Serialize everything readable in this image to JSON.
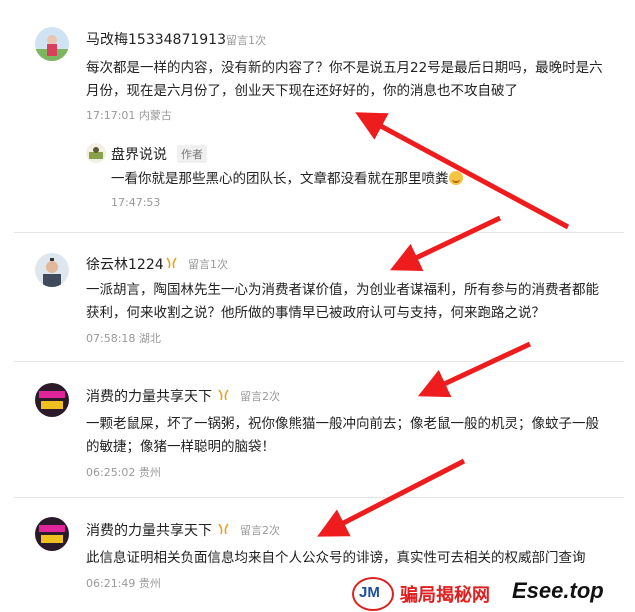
{
  "comments": [
    {
      "name": "马改梅15334871913",
      "count": "留言1次",
      "text": "每次都是一样的内容，没有新的内容了？你不是说五月22号是最后日期吗，最晚时是六月份，现在是六月份了，创业天下现在还好好的，你的消息也不攻自破了",
      "time": "17:17:01 内蒙古",
      "reply": {
        "name": "盘界说说",
        "badge": "作者",
        "text": "一看你就是那些黑心的团队长，文章都没看就在那里喷粪",
        "time": "17:47:53"
      }
    },
    {
      "name": "徐云林1224",
      "count": "留言1次",
      "text": "一派胡言，陶国林先生一心为消费者谋价值，为创业者谋福利，所有参与的消费者都能获利，何来收割之说？他所做的事情早已被政府认可与支持，何来跑路之说？",
      "time": "07:58:18 湖北"
    },
    {
      "name": "消费的力量共享天下",
      "count": "留言2次",
      "text": "一颗老鼠屎，坏了一锅粥，祝你像熊猫一般冲向前去；像老鼠一般的机灵；像蚊子一般的敏捷；像猪一样聪明的脑袋！",
      "time": "06:25:02 贵州"
    },
    {
      "name": "消费的力量共享天下",
      "count": "留言2次",
      "text": "此信息证明相关负面信息均来自个人公众号的诽谤，真实性可去相关的权威部门查询",
      "time": "06:21:49 贵州"
    }
  ],
  "watermark": {
    "logo": "JM",
    "brand": "骗局揭秘网",
    "domain": "Esee.top"
  },
  "colors": {
    "arrow": "#ee1c1c",
    "vip": "#e8a020"
  }
}
